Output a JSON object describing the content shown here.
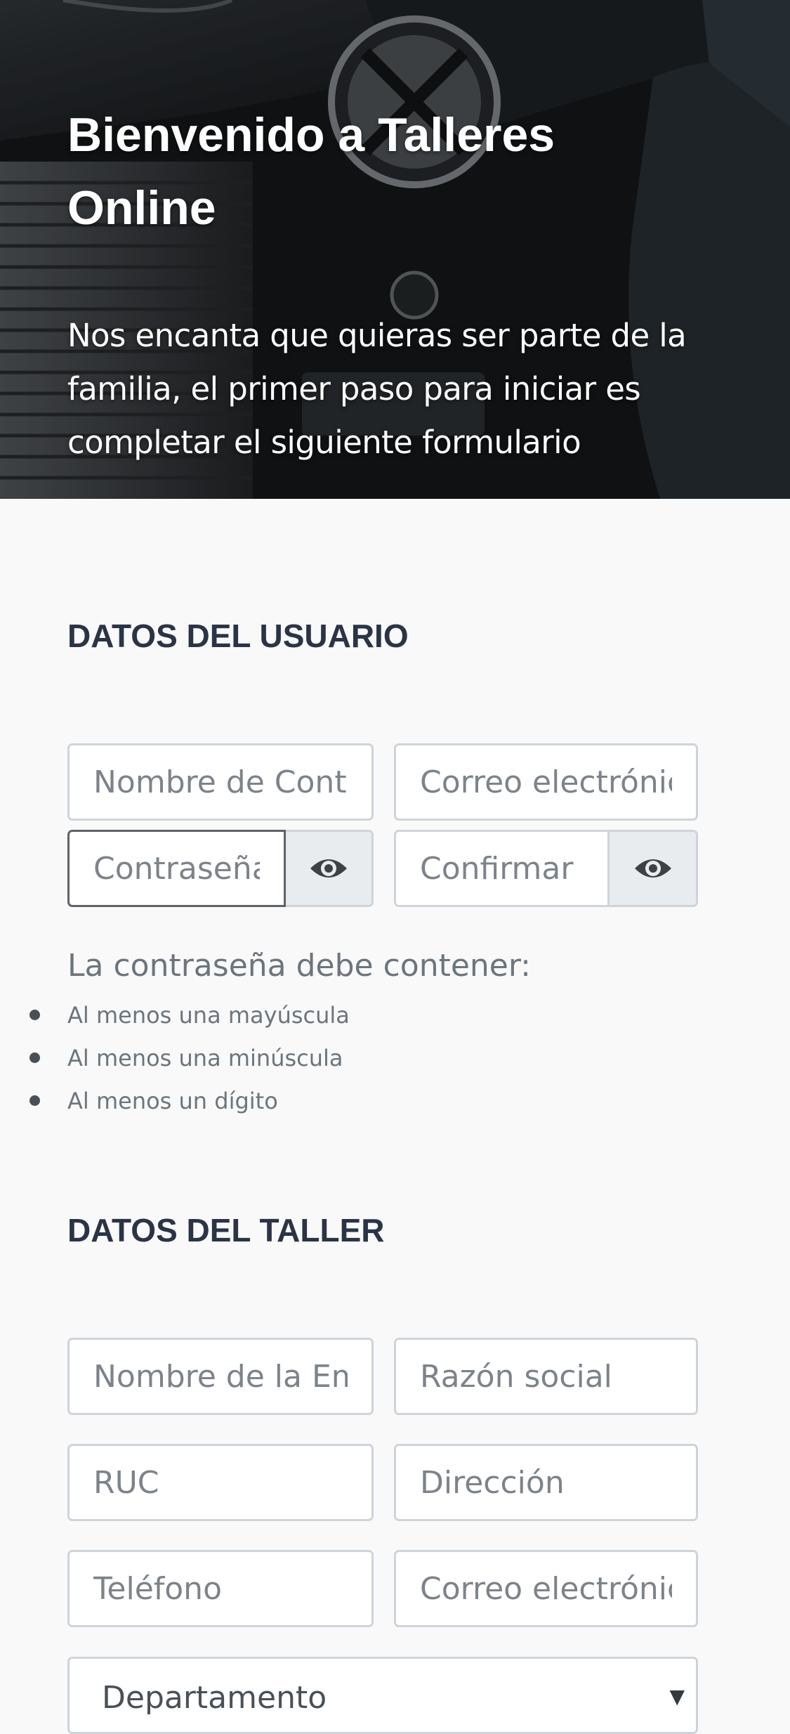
{
  "hero": {
    "title": "Bienvenido a Talleres Online",
    "subtitle": "Nos encanta que quieras ser parte de la familia, el primer paso para iniciar es completar el siguiente formulario"
  },
  "user_section": {
    "title": "DATOS DEL USUARIO",
    "fields": {
      "username_placeholder": "Nombre de Contacto",
      "email_placeholder": "Correo electrónico",
      "password_placeholder": "Contraseña",
      "confirm_placeholder": "Confirmar"
    },
    "show_password_icon": "eye-icon",
    "rules_title": "La contraseña debe contener:",
    "rules": [
      "Al menos una mayúscula",
      "Al menos una minúscula",
      "Al menos un dígito"
    ]
  },
  "workshop_section": {
    "title": "DATOS DEL TALLER",
    "fields": {
      "company_placeholder": "Nombre de la Empresa",
      "business_name_placeholder": "Razón social",
      "ruc_placeholder": "RUC",
      "address_placeholder": "Dirección",
      "phone_placeholder": "Teléfono",
      "email_placeholder": "Correo electrónico"
    },
    "department_select": {
      "selected": "Departamento",
      "caret": "▼"
    }
  },
  "colors": {
    "page_bg": "#f9f9f9",
    "heading": "#2b3446",
    "input_border": "#ced4da",
    "muted_text": "#6c757d",
    "addon_bg": "#e9ecef"
  }
}
